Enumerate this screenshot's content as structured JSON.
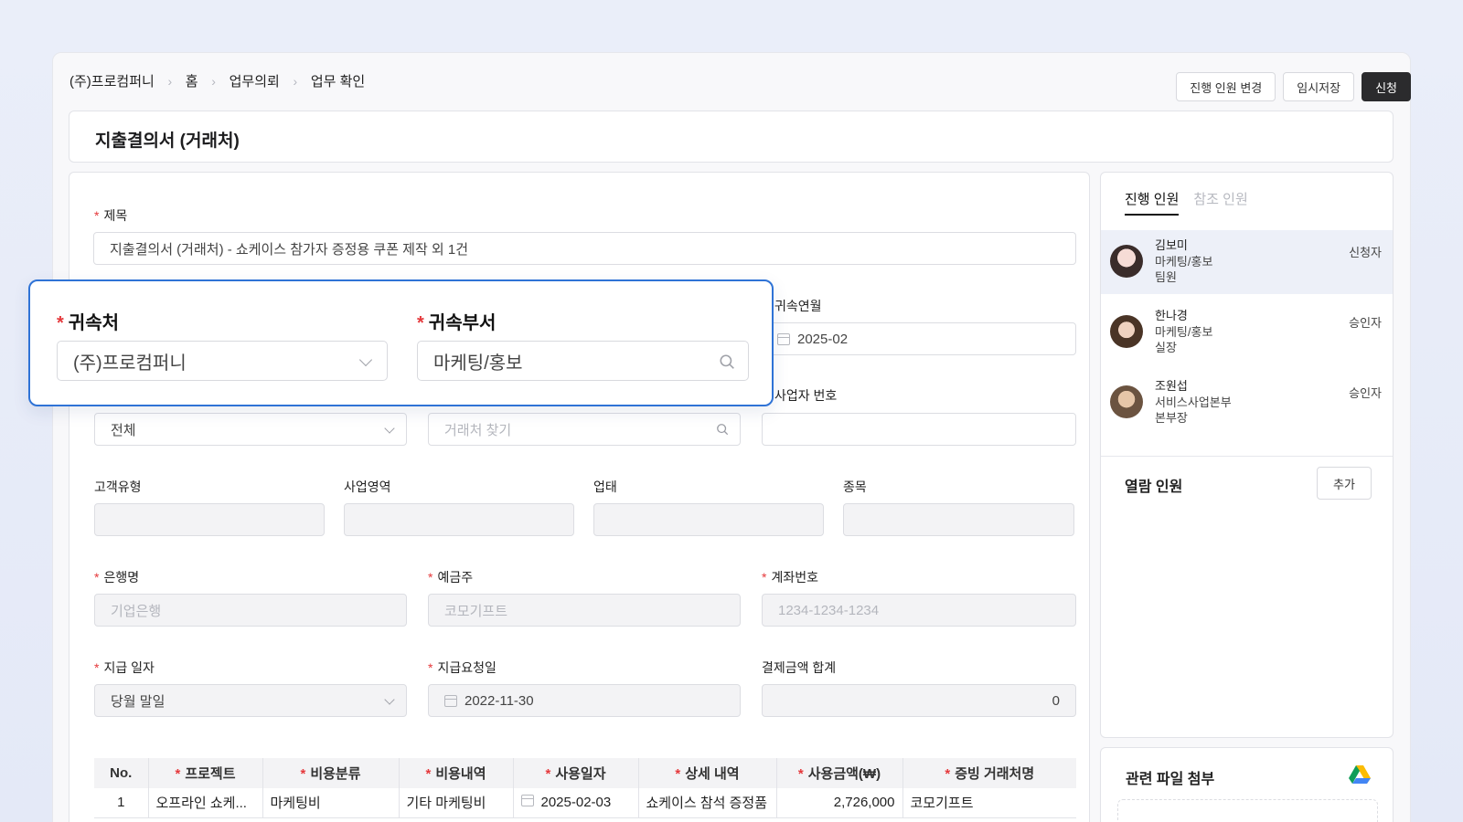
{
  "breadcrumb": [
    "(주)프로컴퍼니",
    "홈",
    "업무의뢰",
    "업무 확인"
  ],
  "top_buttons": {
    "change_people": "진행 인원 변경",
    "temp_save": "임시저장",
    "apply": "신청"
  },
  "doc_title": "지출결의서 (거래처)",
  "form": {
    "subject": {
      "label": "제목",
      "value": "지출결의서 (거래처) - 쇼케이스 참가자 증정용 쿠폰 제작 외 1건"
    },
    "affiliation": {
      "label": "귀속처",
      "value": "(주)프로컴퍼니"
    },
    "department": {
      "label": "귀속부서",
      "value": "마케팅/홍보"
    },
    "month": {
      "label": "귀속연월",
      "value": "2025-02"
    },
    "vendor_type": {
      "value": "전체"
    },
    "vendor_search": {
      "placeholder": "거래처 찾기"
    },
    "business_no": {
      "label": "사업자 번호",
      "value": ""
    },
    "customer_type": {
      "label": "고객유형"
    },
    "business_area": {
      "label": "사업영역"
    },
    "business_form": {
      "label": "업태"
    },
    "business_item": {
      "label": "종목"
    },
    "bank": {
      "label": "은행명",
      "placeholder": "기업은행"
    },
    "holder": {
      "label": "예금주",
      "placeholder": "코모기프트"
    },
    "account": {
      "label": "계좌번호",
      "placeholder": "1234-1234-1234"
    },
    "pay_date": {
      "label": "지급 일자",
      "value": "당월 말일"
    },
    "request_date": {
      "label": "지급요청일",
      "value": "2022-11-30"
    },
    "total": {
      "label": "결제금액 합계",
      "value": "0"
    }
  },
  "table": {
    "headers": [
      "No.",
      "프로젝트",
      "비용분류",
      "비용내역",
      "사용일자",
      "상세 내역",
      "사용금액(₩)",
      "증빙 거래처명"
    ],
    "rows": [
      [
        "1",
        "오프라인 쇼케...",
        "마케팅비",
        "기타 마케팅비",
        "2025-02-03",
        "쇼케이스 참석 증정품",
        "2,726,000",
        "코모기프트"
      ]
    ]
  },
  "side": {
    "tabs": [
      "진행 인원",
      "참조 인원"
    ],
    "people": [
      {
        "name": "김보미",
        "dept": "마케팅/홍보",
        "title": "팀원",
        "role": "신청자"
      },
      {
        "name": "한나경",
        "dept": "마케팅/홍보",
        "title": "실장",
        "role": "승인자"
      },
      {
        "name": "조원섭",
        "dept": "서비스사업본부",
        "title": "본부장",
        "role": "승인자"
      }
    ],
    "viewers_label": "열람 인원",
    "add_label": "추가"
  },
  "files": {
    "label": "관련 파일 첨부",
    "icon": "google-drive-icon"
  }
}
